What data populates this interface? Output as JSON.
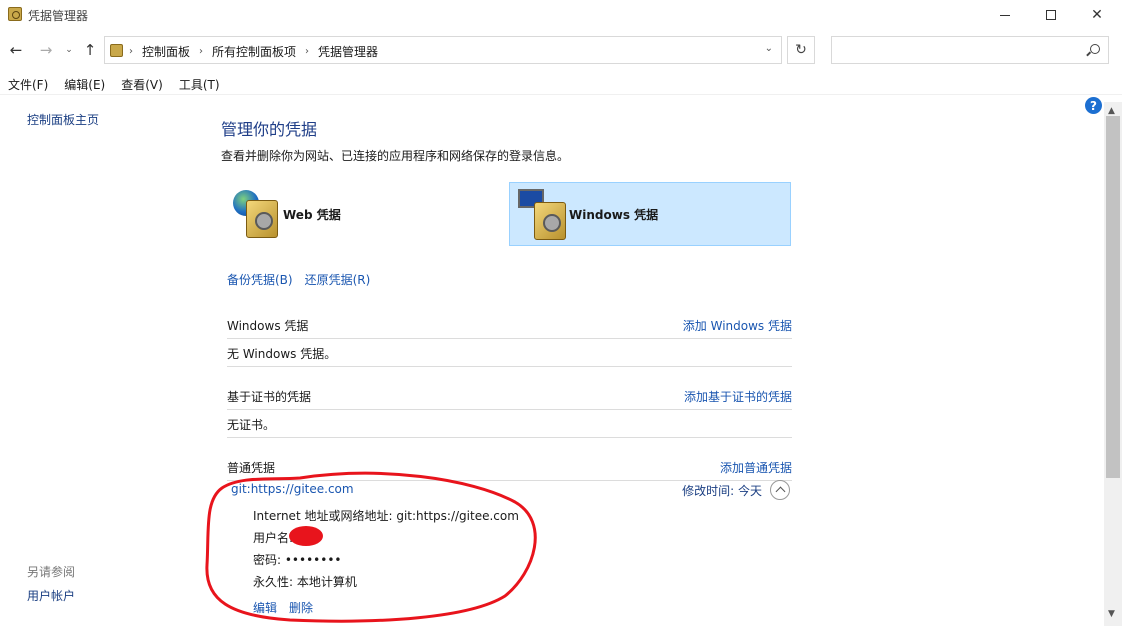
{
  "window": {
    "title": "凭据管理器",
    "controls": {
      "minimize": "",
      "maximize": "",
      "close": "✕"
    }
  },
  "nav": {
    "back": "←",
    "forward": "→",
    "recent": "⌄",
    "up": "↑",
    "breadcrumbs": [
      "控制面板",
      "所有控制面板项",
      "凭据管理器"
    ],
    "separator": "›",
    "dropdown": "⌄",
    "refresh": "↻",
    "search_placeholder": ""
  },
  "menu": [
    "文件(F)",
    "编辑(E)",
    "查看(V)",
    "工具(T)"
  ],
  "sidebar": {
    "home": "控制面板主页",
    "see_also": "另请参阅",
    "user_accounts": "用户帐户"
  },
  "help": "?",
  "main": {
    "title": "管理你的凭据",
    "description": "查看并删除你为网站、已连接的应用程序和网络保存的登录信息。",
    "tiles": {
      "web": "Web 凭据",
      "windows": "Windows 凭据"
    },
    "backup": "备份凭据(B)",
    "restore": "还原凭据(R)",
    "sections": {
      "windows": {
        "title": "Windows 凭据",
        "add": "添加 Windows 凭据",
        "empty": "无 Windows 凭据。"
      },
      "certificate": {
        "title": "基于证书的凭据",
        "add": "添加基于证书的凭据",
        "empty": "无证书。"
      },
      "generic": {
        "title": "普通凭据",
        "add": "添加普通凭据"
      }
    },
    "credential": {
      "name": "git:https://gitee.com",
      "modified_label": "修改时间:",
      "modified_value": "今天",
      "address": "Internet 地址或网络地址: git:https://gitee.com",
      "username_label": "用户名:",
      "password": "密码: ••••••••",
      "persistence": "永久性: 本地计算机",
      "edit": "编辑",
      "delete": "删除"
    }
  },
  "colors": {
    "link": "#1a56b0",
    "title_blue": "#1e3d87",
    "selected_tile": "#cce8ff",
    "annotation_red": "#e8141c"
  }
}
